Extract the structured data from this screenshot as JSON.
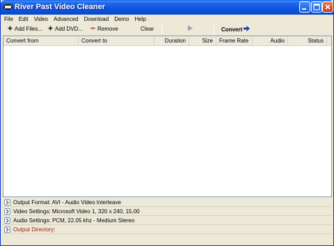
{
  "window": {
    "title": "River Past Video Cleaner"
  },
  "menu": [
    "File",
    "Edit",
    "Video",
    "Advanced",
    "Download",
    "Demo",
    "Help"
  ],
  "toolbar": {
    "add_files": "Add Files...",
    "add_dvd": "Add DVD...",
    "remove": "Remove",
    "clear": "Clear",
    "convert": "Convert"
  },
  "list": {
    "columns": [
      "Convert from",
      "Convert to",
      "Duration",
      "Size",
      "Frame Rate",
      "Audio",
      "Status"
    ],
    "rows": []
  },
  "settings": {
    "output_format": "Output Format: AVI - Audio Video Interleave",
    "video": "Video Settings: Microsoft Video 1, 320 x 240, 15.00",
    "audio": "Audio Settings: PCM, 22.05 khz - Medium Stereo",
    "output_directory": "Output Directory:"
  },
  "icons": {
    "app": "film-icon",
    "add": "plus-icon",
    "remove": "minus-icon",
    "play": "play-icon",
    "convert": "arrow-right-icon",
    "expand": "expand-chevron-icon"
  },
  "colors": {
    "titlebar": "#0c55e2",
    "remove_accent": "#c0392b",
    "convert_arrow": "#1f3fa8",
    "output_directory_text": "#9b1c00"
  }
}
